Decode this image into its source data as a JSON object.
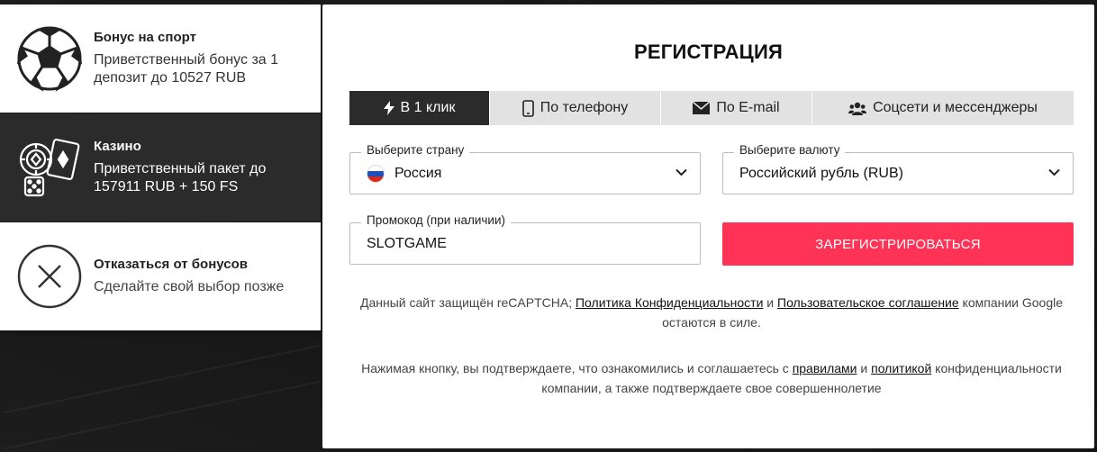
{
  "bonuses": [
    {
      "title": "Бонус на спорт",
      "desc": "Приветственный бонус за 1 депозит до 10527 RUB",
      "icon": "soccer-ball-icon"
    },
    {
      "title": "Казино",
      "desc": "Приветственный пакет до 157911 RUB + 150 FS",
      "icon": "casino-chips-cards-dice-icon"
    },
    {
      "title": "Отказаться от бонусов",
      "desc": "Сделайте свой выбор позже",
      "icon": "close-circle-icon"
    }
  ],
  "registration": {
    "title": "РЕГИСТРАЦИЯ",
    "tabs": [
      {
        "label": "В 1 клик",
        "icon": "lightning-icon",
        "active": true
      },
      {
        "label": "По телефону",
        "icon": "phone-icon"
      },
      {
        "label": "По E-mail",
        "icon": "envelope-icon"
      },
      {
        "label": "Соцсети и мессенджеры",
        "icon": "users-icon"
      }
    ],
    "country": {
      "label": "Выберите страну",
      "value": "Россия"
    },
    "currency": {
      "label": "Выберите валюту",
      "value": "Российский рубль (RUB)"
    },
    "promo": {
      "label": "Промокод (при наличии)",
      "value": "SLOTGAME"
    },
    "submit_label": "ЗАРЕГИСТРИРОВАТЬСЯ",
    "recaptcha": {
      "text_1": "Данный сайт защищён reCAPTCHA; ",
      "link_privacy": "Политика Конфиденциальности",
      "text_2": " и ",
      "link_terms": "Пользовательское соглашение",
      "text_3": " компании Google остаются в силе."
    },
    "consent": {
      "text_1": "Нажимая кнопку, вы подтверждаете, что ознакомились и соглашаетесь с ",
      "link_rules": "правилами",
      "text_2": " и ",
      "link_policy": "политикой",
      "text_3": " конфиденциальности компании, а также подтверждаете свое совершеннолетие"
    }
  },
  "colors": {
    "accent": "#ff3355",
    "dark_tab": "#2b2b2b",
    "flag_white": "#ffffff",
    "flag_blue": "#1f4fb8",
    "flag_red": "#d52b1e"
  }
}
